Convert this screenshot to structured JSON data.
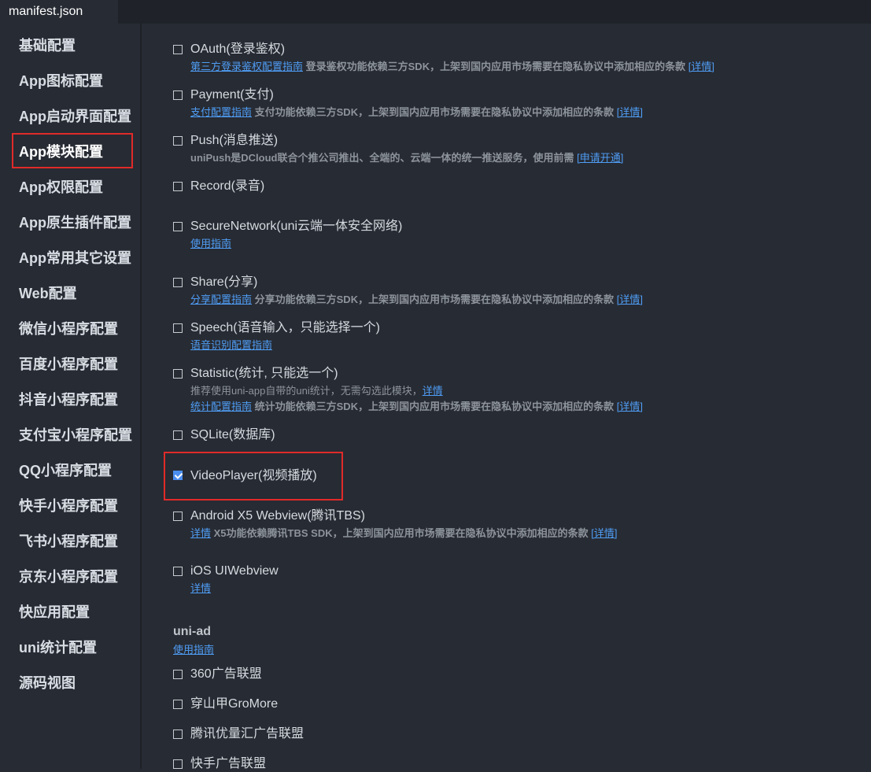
{
  "tab": {
    "label": "manifest.json"
  },
  "sidebar": {
    "items": [
      "基础配置",
      "App图标配置",
      "App启动界面配置",
      "App模块配置",
      "App权限配置",
      "App原生插件配置",
      "App常用其它设置",
      "Web配置",
      "微信小程序配置",
      "百度小程序配置",
      "抖音小程序配置",
      "支付宝小程序配置",
      "QQ小程序配置",
      "快手小程序配置",
      "飞书小程序配置",
      "京东小程序配置",
      "快应用配置",
      "uni统计配置",
      "源码视图"
    ],
    "selected": "App模块配置"
  },
  "modules": {
    "oauth": {
      "title": "OAuth(登录鉴权)",
      "link": "第三方登录鉴权配置指南",
      "text": "登录鉴权功能依赖三方SDK，上架到国内应用市场需要在隐私协议中添加相应的条款",
      "detail": "[详情]",
      "checked": false
    },
    "payment": {
      "title": "Payment(支付)",
      "link": "支付配置指南",
      "text": "支付功能依赖三方SDK，上架到国内应用市场需要在隐私协议中添加相应的条款",
      "detail": "[详情]",
      "checked": false
    },
    "push": {
      "title": "Push(消息推送)",
      "text": "uniPush是DCloud联合个推公司推出、全端的、云端一体的统一推送服务，使用前需",
      "detail": "[申请开通]",
      "checked": false
    },
    "record": {
      "title": "Record(录音)",
      "checked": false
    },
    "securenetwork": {
      "title": "SecureNetwork(uni云端一体安全网络)",
      "link": "使用指南",
      "checked": false
    },
    "share": {
      "title": "Share(分享)",
      "link": "分享配置指南",
      "text": "分享功能依赖三方SDK，上架到国内应用市场需要在隐私协议中添加相应的条款",
      "detail": "[详情]",
      "checked": false
    },
    "speech": {
      "title": "Speech(语音输入，只能选择一个)",
      "link": "语音识别配置指南",
      "checked": false
    },
    "statistic": {
      "title": "Statistic(统计, 只能选一个)",
      "note": "推荐使用uni-app自带的uni统计，无需勾选此模块，",
      "note_link": "详情",
      "link": "统计配置指南",
      "text": "统计功能依赖三方SDK，上架到国内应用市场需要在隐私协议中添加相应的条款",
      "detail": "[详情]",
      "checked": false
    },
    "sqlite": {
      "title": "SQLite(数据库)",
      "checked": false
    },
    "videoplayer": {
      "title": "VideoPlayer(视频播放)",
      "checked": true
    },
    "x5": {
      "title": "Android X5 Webview(腾讯TBS)",
      "link": "详情",
      "text": "X5功能依赖腾讯TBS SDK，上架到国内应用市场需要在隐私协议中添加相应的条款",
      "detail": "[详情]",
      "checked": false
    },
    "uiwebview": {
      "title": "iOS UIWebview",
      "link": "详情",
      "checked": false
    }
  },
  "uniad": {
    "title": "uni-ad",
    "link": "使用指南",
    "items": [
      {
        "title": "360广告联盟",
        "checked": false
      },
      {
        "title": "穿山甲GroMore",
        "checked": false
      },
      {
        "title": "腾讯优量汇广告联盟",
        "checked": false
      },
      {
        "title": "快手广告联盟",
        "checked": false
      }
    ]
  }
}
